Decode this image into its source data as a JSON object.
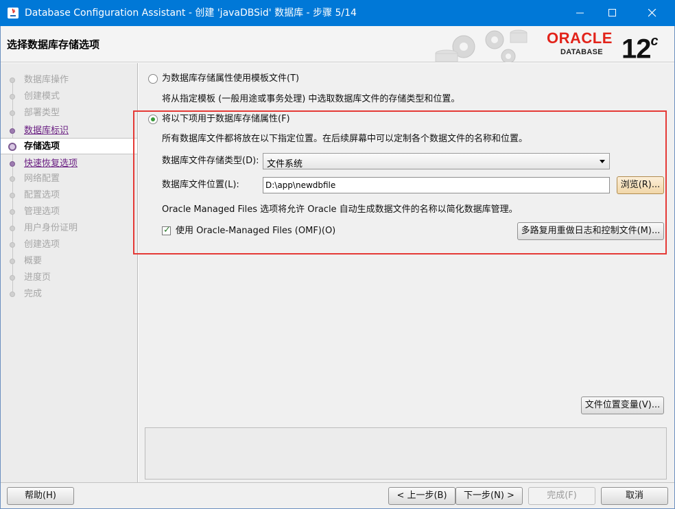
{
  "window": {
    "title": "Database Configuration Assistant - 创建 'javaDBSid' 数据库 - 步骤 5/14"
  },
  "header": {
    "page_title": "选择数据库存储选项",
    "logo_word": "ORACLE",
    "logo_sub": "DATABASE",
    "version": "12",
    "version_sup": "c"
  },
  "nav": {
    "items": [
      {
        "label": "数据库操作",
        "state": "disabled"
      },
      {
        "label": "创建模式",
        "state": "disabled"
      },
      {
        "label": "部署类型",
        "state": "disabled"
      },
      {
        "label": "数据库标识",
        "state": "link"
      },
      {
        "label": "存储选项",
        "state": "active"
      },
      {
        "label": "快速恢复选项",
        "state": "link"
      },
      {
        "label": "网络配置",
        "state": "disabled"
      },
      {
        "label": "配置选项",
        "state": "disabled"
      },
      {
        "label": "管理选项",
        "state": "disabled"
      },
      {
        "label": "用户身份证明",
        "state": "disabled"
      },
      {
        "label": "创建选项",
        "state": "disabled"
      },
      {
        "label": "概要",
        "state": "disabled"
      },
      {
        "label": "进度页",
        "state": "disabled"
      },
      {
        "label": "完成",
        "state": "disabled"
      }
    ]
  },
  "main": {
    "option_template_label": "为数据库存储属性使用模板文件(T)",
    "option_template_desc": "将从指定模板 (一般用途或事务处理) 中选取数据库文件的存储类型和位置。",
    "option_custom_label": "将以下项用于数据库存储属性(F)",
    "option_custom_desc": "所有数据库文件都将放在以下指定位置。在后续屏幕中可以定制各个数据文件的名称和位置。",
    "storage_type_label": "数据库文件存储类型(D):",
    "storage_type_value": "文件系统",
    "location_label": "数据库文件位置(L):",
    "location_value": "D:\\app\\newdbfile",
    "browse_button": "浏览(R)...",
    "omf_desc": "Oracle Managed Files 选项将允许 Oracle 自动生成数据文件的名称以简化数据库管理。",
    "omf_checkbox_label": "使用 Oracle-Managed Files (OMF)(O)",
    "omf_checked": true,
    "multiplex_button": "多路复用重做日志和控制文件(M)...",
    "file_location_vars_button": "文件位置变量(V)..."
  },
  "bottom": {
    "help": "帮助(H)",
    "back": "< 上一步(B)",
    "next": "下一步(N) >",
    "finish": "完成(F)",
    "cancel": "取消"
  },
  "colors": {
    "titlebar": "#0078d7",
    "oracle_red": "#e2231a",
    "nav_link": "#6a1f82",
    "highlight_border": "#e53935"
  }
}
